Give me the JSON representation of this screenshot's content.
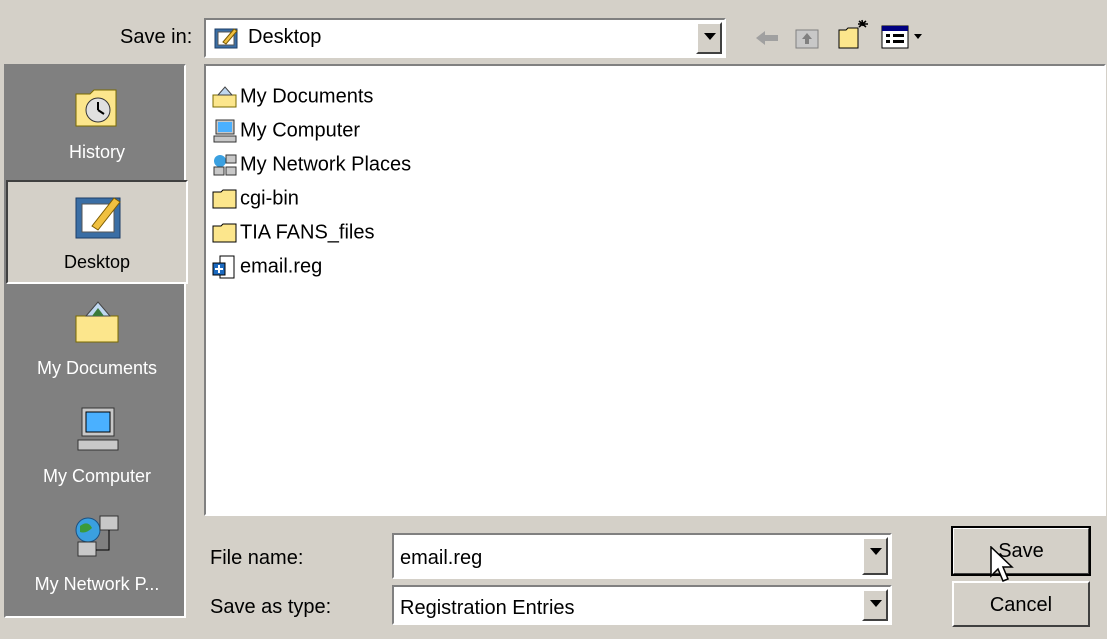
{
  "header": {
    "save_in_label": "Save in:",
    "location_value": "Desktop"
  },
  "toolbar": {
    "icons": [
      "back-arrow-icon",
      "up-folder-icon",
      "new-folder-icon",
      "view-menu-icon"
    ]
  },
  "places": [
    {
      "label": "History",
      "icon": "history-icon",
      "active": false
    },
    {
      "label": "Desktop",
      "icon": "desktop-icon",
      "active": true
    },
    {
      "label": "My Documents",
      "icon": "my-documents-icon",
      "active": false
    },
    {
      "label": "My Computer",
      "icon": "my-computer-icon",
      "active": false
    },
    {
      "label": "My Network P...",
      "icon": "my-network-places-icon",
      "active": false
    }
  ],
  "files": [
    {
      "name": "My Documents",
      "icon": "my-documents-icon"
    },
    {
      "name": "My Computer",
      "icon": "my-computer-icon"
    },
    {
      "name": "My Network Places",
      "icon": "network-places-icon"
    },
    {
      "name": "cgi-bin",
      "icon": "folder-icon"
    },
    {
      "name": "TIA FANS_files",
      "icon": "folder-icon"
    },
    {
      "name": "email.reg",
      "icon": "registry-file-icon"
    }
  ],
  "form": {
    "file_name_label": "File name:",
    "file_name_value": "email.reg",
    "save_type_label": "Save as type:",
    "save_type_value": "Registration Entries"
  },
  "buttons": {
    "save_label": "Save",
    "cancel_label": "Cancel"
  }
}
